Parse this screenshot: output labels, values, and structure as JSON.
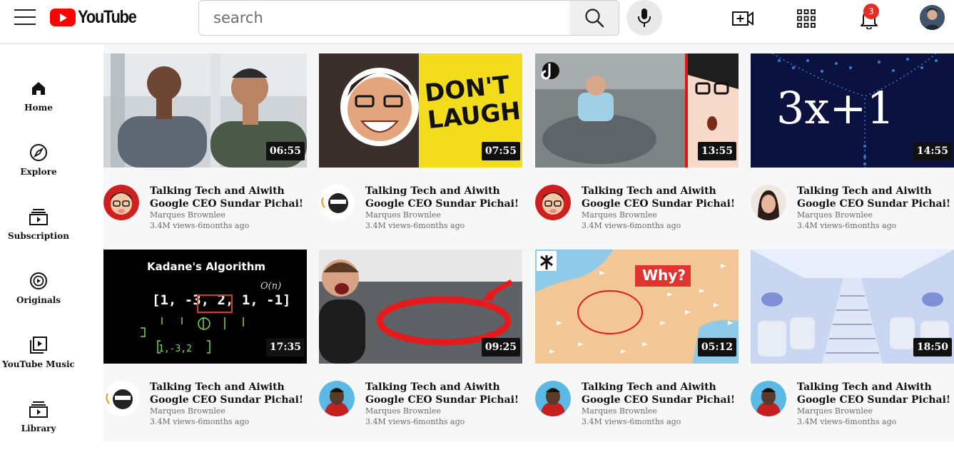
{
  "header": {
    "logo_text": "YouTube",
    "search_placeholder": "search",
    "notification_count": "3",
    "icons": [
      "menu-icon",
      "search-icon",
      "mic-icon",
      "create-video-icon",
      "apps-grid-icon",
      "bell-icon"
    ]
  },
  "sidebar": {
    "items": [
      {
        "label": "Home",
        "icon": "home-icon"
      },
      {
        "label": "Explore",
        "icon": "compass-icon"
      },
      {
        "label": "Subscription",
        "icon": "subscriptions-icon"
      },
      {
        "label": "Originals",
        "icon": "originals-icon"
      },
      {
        "label": "YouTube Music",
        "icon": "music-icon"
      },
      {
        "label": "Library",
        "icon": "library-icon"
      }
    ]
  },
  "videos": [
    {
      "title": "Talking Tech and Aiwith Google CEO Sundar Pichai!",
      "channel": "Marques Brownlee",
      "meta": "3.4M views-6months ago",
      "duration": "06:55",
      "thumb_text": ""
    },
    {
      "title": "Talking Tech and Aiwith Google CEO Sundar Pichai!",
      "channel": "Marques Brownlee",
      "meta": "3.4M views-6months ago",
      "duration": "07:55",
      "thumb_text": "DON'T LAUGH"
    },
    {
      "title": "Talking Tech and Aiwith Google CEO Sundar Pichai!",
      "channel": "Marques Brownlee",
      "meta": "3.4M views-6months ago",
      "duration": "13:55",
      "thumb_text": ""
    },
    {
      "title": "Talking Tech and Aiwith Google CEO Sundar Pichai!",
      "channel": "Marques Brownlee",
      "meta": "3.4M views-6months ago",
      "duration": "14:55",
      "thumb_text": "3x+1"
    },
    {
      "title": "Talking Tech and Aiwith Google CEO Sundar Pichai!",
      "channel": "Marques Brownlee",
      "meta": "3.4M views-6months ago",
      "duration": "17:35",
      "thumb_text": "Kadane's Algorithm"
    },
    {
      "title": "Talking Tech and Aiwith Google CEO Sundar Pichai!",
      "channel": "Marques Brownlee",
      "meta": "3.4M views-6months ago",
      "duration": "09:25",
      "thumb_text": ""
    },
    {
      "title": "Talking Tech and Aiwith Google CEO Sundar Pichai!",
      "channel": "Marques Brownlee",
      "meta": "3.4M views-6months ago",
      "duration": "05:12",
      "thumb_text": "Why?"
    },
    {
      "title": "Talking Tech and Aiwith Google CEO Sundar Pichai!",
      "channel": "Marques Brownlee",
      "meta": "3.4M views-6months ago",
      "duration": "18:50",
      "thumb_text": ""
    }
  ],
  "colors": {
    "brand_red": "#ff0000",
    "badge_red": "#e52b23",
    "feed_bg": "#f7f7f7"
  }
}
